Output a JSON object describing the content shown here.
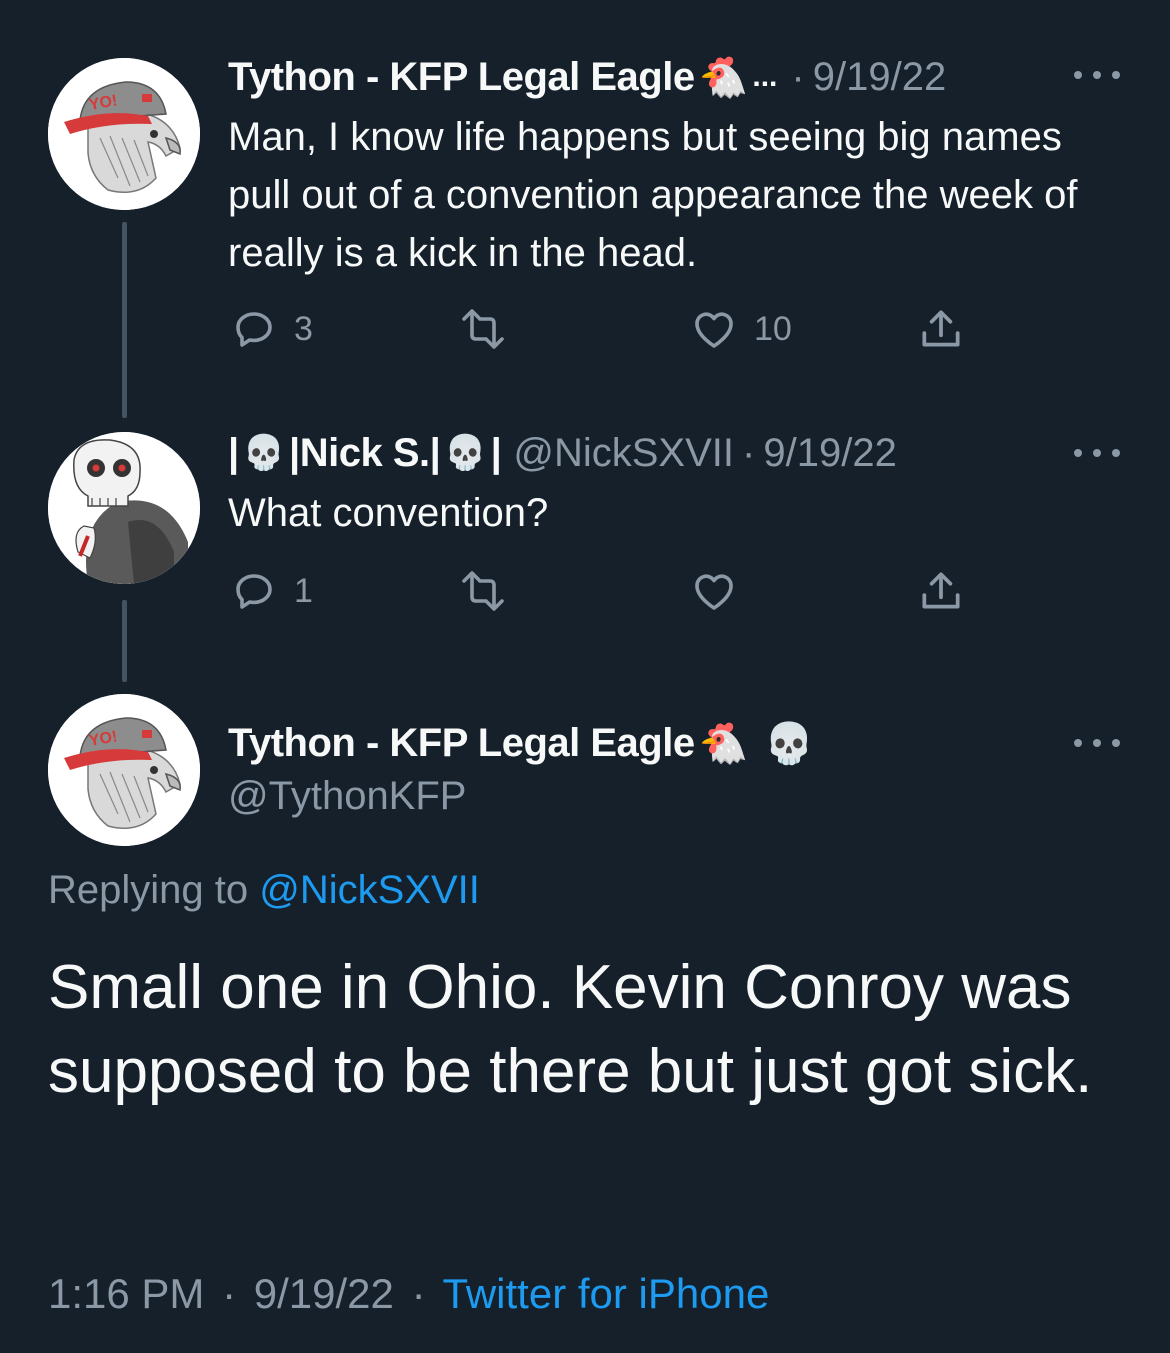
{
  "tweet1": {
    "display_name": "Tython - KFP Legal Eagle",
    "emoji": "🐔",
    "truncation": "...",
    "separator": "·",
    "date": "9/19/22",
    "text": "Man, I know life happens but seeing big names pull out of a convention appearance the week of really is a kick in the head.",
    "replies": "3",
    "likes": "10"
  },
  "tweet2": {
    "display_name_prefix": "|",
    "skull": "💀",
    "display_name_core": "|Nick S.|",
    "display_name_suffix": "|",
    "handle": "@NickSXVII",
    "separator": "·",
    "date": "9/19/22",
    "text": "What convention?",
    "replies": "1"
  },
  "main_tweet": {
    "display_name": "Tython - KFP Legal Eagle",
    "emoji_chicken": "🐔",
    "emoji_skull": "💀",
    "handle": "@TythonKFP",
    "replying_label": "Replying to",
    "replying_handle": "@NickSXVII",
    "text": "Small one in Ohio. Kevin Conroy was supposed to be there but just got sick.",
    "time": "1:16 PM",
    "separator": "·",
    "date": "9/19/22",
    "source": "Twitter for iPhone"
  },
  "colors": {
    "background": "#15202b",
    "text": "#f7f9f9",
    "muted": "#8b98a5",
    "link": "#1d9bf0",
    "thread_line": "#425364"
  },
  "icons": [
    "eagle-avatar",
    "skull-avatar",
    "more-options-icon",
    "reply-icon",
    "retweet-icon",
    "like-icon",
    "share-icon"
  ]
}
